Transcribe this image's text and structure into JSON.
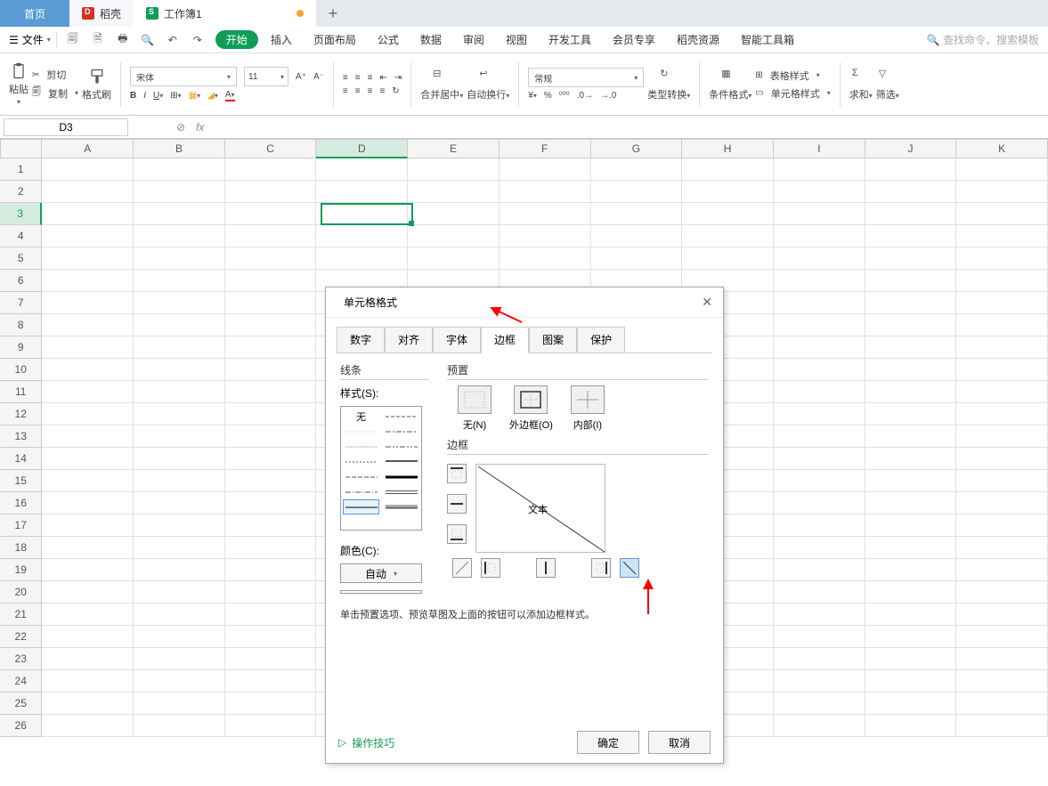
{
  "tabs": {
    "home": "首页",
    "daoke": "稻壳",
    "doc": "工作簿1"
  },
  "menu": {
    "file": "文件",
    "items": [
      "开始",
      "插入",
      "页面布局",
      "公式",
      "数据",
      "审阅",
      "视图",
      "开发工具",
      "会员专享",
      "稻壳资源",
      "智能工具箱"
    ],
    "search_ph": "查找命令、搜索模板"
  },
  "ribbon": {
    "paste": "粘贴",
    "cut": "剪切",
    "copy": "复制",
    "format_painter": "格式刷",
    "font_name": "宋体",
    "font_size": "11",
    "merge": "合并居中",
    "wrap": "自动换行",
    "num_fmt": "常规",
    "type_convert": "类型转换",
    "cond_fmt": "条件格式",
    "table_style": "表格样式",
    "cell_style": "单元格样式",
    "sum": "求和",
    "filter": "筛选"
  },
  "fx": {
    "name_box": "D3",
    "fx_label": "fx"
  },
  "grid": {
    "cols": [
      "A",
      "B",
      "C",
      "D",
      "E",
      "F",
      "G",
      "H",
      "I",
      "J",
      "K"
    ],
    "rows": 26,
    "active_col": "D",
    "active_row": 3
  },
  "dialog": {
    "title": "单元格格式",
    "tabs": [
      "数字",
      "对齐",
      "字体",
      "边框",
      "图案",
      "保护"
    ],
    "active_tab": "边框",
    "line": {
      "section": "线条",
      "style_label": "样式(S):",
      "none": "无",
      "color_label": "颜色(C):",
      "color_value": "自动"
    },
    "preset": {
      "section": "预置",
      "none": "无(N)",
      "outer": "外边框(O)",
      "inner": "内部(I)"
    },
    "border": {
      "section": "边框",
      "preview_text": "文本"
    },
    "hint": "单击预置选项、预览草图及上面的按钮可以添加边框样式。",
    "tips": "操作技巧",
    "ok": "确定",
    "cancel": "取消"
  }
}
